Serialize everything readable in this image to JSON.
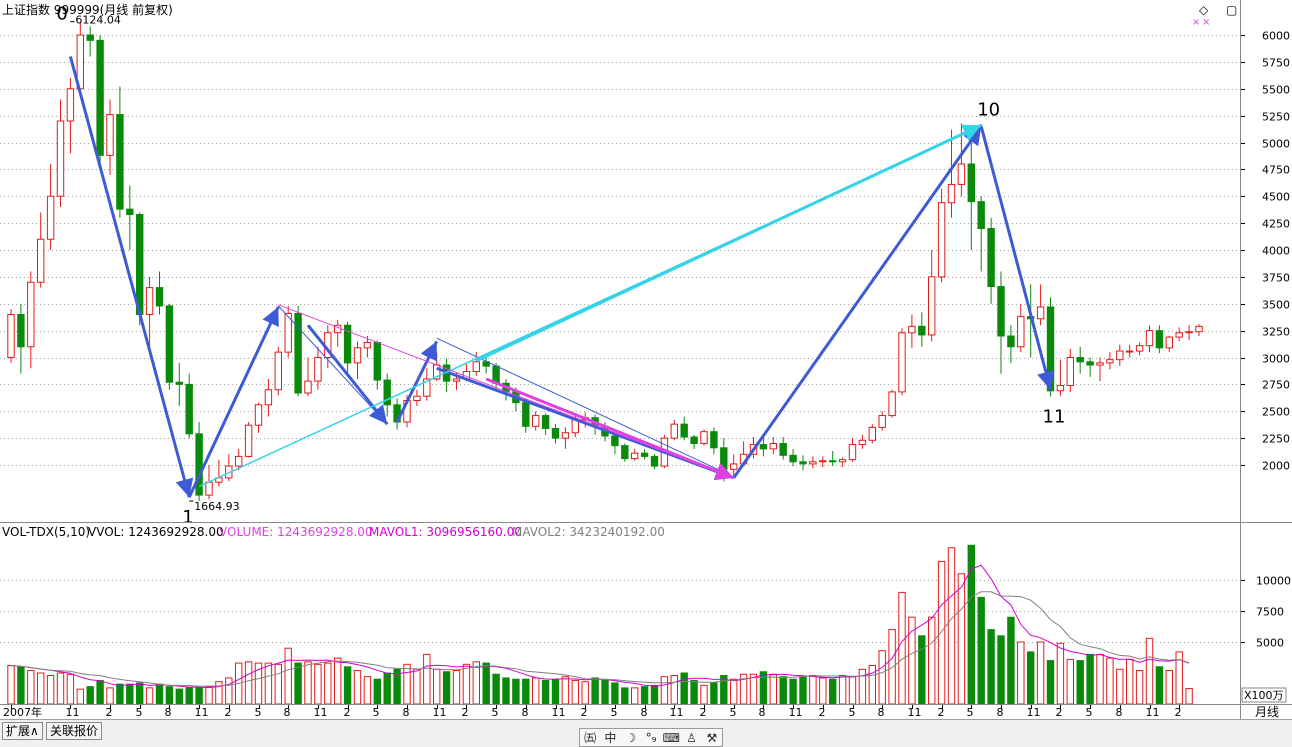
{
  "header": {
    "title": "上证指数 999999(月线 前复权)",
    "corner_icons": [
      "◇",
      "▢"
    ]
  },
  "volume_header": {
    "name": "VOL-TDX(5,10)",
    "vvol": "VVOL: 1243692928.00",
    "volume": "VOLUME: 1243692928.00",
    "mavol1": "MAVOL1: 3096956160.00",
    "mavol2": "MAVOL2: 3423240192.00"
  },
  "bottom_bar": {
    "tab_expand": "扩展∧",
    "tab_quote": "关联报价",
    "tools": [
      {
        "icon": "stock-icon",
        "glyph": "㈤"
      },
      {
        "icon": "chinese-char-icon",
        "glyph": "中"
      },
      {
        "icon": "moon-icon",
        "glyph": "☽"
      },
      {
        "icon": "degree-icon",
        "glyph": "°₉"
      },
      {
        "icon": "keyboard-icon",
        "glyph": "⌨"
      },
      {
        "icon": "person-icon",
        "glyph": "♙"
      },
      {
        "icon": "wrench-icon",
        "glyph": "⚒"
      }
    ]
  },
  "period_label": "月线",
  "colors": {
    "up": "#e21b1b",
    "down": "#0a8a0a",
    "wave": "#3d5bd6",
    "cyan": "#35d3e6",
    "magenta": "#e040e0",
    "ma1": "#d400d4",
    "ma2": "#808080",
    "grid": "#888888"
  },
  "chart_data": [
    {
      "type": "candlestick",
      "title": "上证指数 999999(月线 前复权)",
      "y_ticks": [
        2000,
        2250,
        2500,
        2750,
        3000,
        3250,
        3500,
        3750,
        4000,
        4250,
        4500,
        4750,
        5000,
        5250,
        5500,
        5750,
        6000
      ],
      "ylim": [
        1550,
        6250
      ],
      "x_tick_labels": [
        "2007年",
        "11",
        "2",
        "5",
        "8",
        "11",
        "2",
        "5",
        "8",
        "11",
        "2",
        "5",
        "8",
        "11",
        "2",
        "5",
        "8",
        "11",
        "2",
        "5",
        "8",
        "11",
        "2",
        "5",
        "8",
        "11",
        "2",
        "5",
        "8",
        "11",
        "2",
        "5",
        "8",
        "11",
        "2",
        "5",
        "8",
        "11",
        "2"
      ],
      "x_tick_index": [
        0,
        6,
        10,
        13,
        16,
        19,
        22,
        25,
        28,
        31,
        34,
        37,
        40,
        43,
        46,
        49,
        52,
        55,
        58,
        61,
        64,
        67,
        70,
        73,
        76,
        79,
        82,
        85,
        88,
        91,
        94,
        97,
        100,
        103,
        106,
        109,
        112,
        115,
        118
      ],
      "annotations": [
        {
          "label": "0",
          "price_label": "6124.04",
          "index": 6,
          "price": 6124.04
        },
        {
          "label": "1",
          "price_label": "1664.93",
          "index": 18,
          "price": 1664.93
        },
        {
          "label": "10",
          "index": 98,
          "price": 5178
        },
        {
          "label": "11",
          "index": 105,
          "price": 2638
        }
      ],
      "candles": [
        [
          3000,
          3400,
          3450,
          2950
        ],
        [
          3400,
          3100,
          3500,
          2850
        ],
        [
          3100,
          3700,
          3800,
          2900
        ],
        [
          3700,
          4100,
          4350,
          3650
        ],
        [
          4100,
          4500,
          4800,
          4000
        ],
        [
          4500,
          5200,
          5400,
          4400
        ],
        [
          5200,
          5500,
          5600,
          4900
        ],
        [
          5500,
          6000,
          6124,
          5450
        ],
        [
          6000,
          5950,
          6080,
          5800
        ],
        [
          5950,
          4880,
          6000,
          4780
        ],
        [
          4880,
          5260,
          5400,
          4700
        ],
        [
          5260,
          4380,
          5520,
          4300
        ],
        [
          4380,
          4330,
          4600,
          4000
        ],
        [
          4330,
          3400,
          4350,
          3300
        ],
        [
          3400,
          3650,
          3750,
          3100
        ],
        [
          3650,
          3480,
          3800,
          3400
        ],
        [
          3480,
          2770,
          3500,
          2700
        ],
        [
          2770,
          2750,
          2950,
          2550
        ],
        [
          2750,
          2290,
          2850,
          2250
        ],
        [
          2290,
          1720,
          2400,
          1664.93
        ],
        [
          1720,
          1840,
          2000,
          1680
        ],
        [
          1840,
          1880,
          2050,
          1800
        ],
        [
          1880,
          1990,
          2100,
          1850
        ],
        [
          1990,
          2080,
          2150,
          1950
        ],
        [
          2080,
          2370,
          2400,
          2070
        ],
        [
          2370,
          2560,
          2580,
          2300
        ],
        [
          2560,
          2700,
          2800,
          2450
        ],
        [
          2700,
          3050,
          3100,
          2650
        ],
        [
          3050,
          3410,
          3480,
          3000
        ],
        [
          3410,
          2670,
          3480,
          2640
        ],
        [
          2670,
          2780,
          3000,
          2640
        ],
        [
          2780,
          3000,
          3100,
          2700
        ],
        [
          3000,
          3230,
          3300,
          2900
        ],
        [
          3230,
          3300,
          3350,
          3100
        ],
        [
          3300,
          2950,
          3330,
          2850
        ],
        [
          2950,
          3090,
          3150,
          2800
        ],
        [
          3090,
          3140,
          3200,
          3000
        ],
        [
          3140,
          2790,
          3160,
          2700
        ],
        [
          2790,
          2560,
          2850,
          2450
        ],
        [
          2560,
          2400,
          2620,
          2330
        ],
        [
          2400,
          2600,
          2650,
          2350
        ],
        [
          2600,
          2640,
          2700,
          2550
        ],
        [
          2640,
          2800,
          2900,
          2600
        ],
        [
          2800,
          2930,
          3050,
          2780
        ],
        [
          2930,
          2780,
          2990,
          2680
        ],
        [
          2780,
          2800,
          2860,
          2700
        ],
        [
          2800,
          2870,
          2940,
          2780
        ],
        [
          2870,
          2960,
          3050,
          2830
        ],
        [
          2960,
          2920,
          3000,
          2850
        ],
        [
          2920,
          2760,
          2950,
          2700
        ],
        [
          2760,
          2680,
          2800,
          2600
        ],
        [
          2680,
          2580,
          2720,
          2500
        ],
        [
          2580,
          2360,
          2620,
          2300
        ],
        [
          2360,
          2460,
          2500,
          2320
        ],
        [
          2460,
          2340,
          2480,
          2280
        ],
        [
          2340,
          2250,
          2380,
          2200
        ],
        [
          2250,
          2300,
          2350,
          2150
        ],
        [
          2300,
          2420,
          2470,
          2260
        ],
        [
          2420,
          2440,
          2490,
          2350
        ],
        [
          2440,
          2360,
          2470,
          2280
        ],
        [
          2360,
          2270,
          2400,
          2220
        ],
        [
          2270,
          2180,
          2300,
          2100
        ],
        [
          2180,
          2060,
          2200,
          2030
        ],
        [
          2060,
          2110,
          2150,
          2040
        ],
        [
          2110,
          2080,
          2150,
          2050
        ],
        [
          2080,
          1990,
          2100,
          1960
        ],
        [
          1990,
          2250,
          2280,
          1970
        ],
        [
          2250,
          2380,
          2420,
          2230
        ],
        [
          2380,
          2260,
          2450,
          2230
        ],
        [
          2260,
          2200,
          2280,
          2150
        ],
        [
          2200,
          2310,
          2330,
          2180
        ],
        [
          2310,
          2160,
          2350,
          2100
        ],
        [
          2160,
          1960,
          2250,
          1849
        ],
        [
          1960,
          2010,
          2100,
          1900
        ],
        [
          2010,
          2100,
          2220,
          1990
        ],
        [
          2100,
          2190,
          2260,
          2060
        ],
        [
          2190,
          2150,
          2270,
          2080
        ],
        [
          2150,
          2200,
          2260,
          2100
        ],
        [
          2200,
          2090,
          2260,
          2050
        ],
        [
          2090,
          2030,
          2150,
          1990
        ],
        [
          2030,
          2010,
          2090,
          1950
        ],
        [
          2010,
          2030,
          2080,
          1970
        ],
        [
          2030,
          2040,
          2080,
          1980
        ],
        [
          2040,
          2030,
          2130,
          1990
        ],
        [
          2030,
          2050,
          2070,
          1980
        ],
        [
          2050,
          2190,
          2250,
          2030
        ],
        [
          2190,
          2230,
          2280,
          2150
        ],
        [
          2230,
          2350,
          2380,
          2200
        ],
        [
          2350,
          2460,
          2500,
          2320
        ],
        [
          2460,
          2680,
          2700,
          2440
        ],
        [
          2680,
          3230,
          3270,
          2650
        ],
        [
          3230,
          3290,
          3400,
          3090
        ],
        [
          3290,
          3210,
          3420,
          3100
        ],
        [
          3210,
          3750,
          4000,
          3150
        ],
        [
          3750,
          4440,
          4570,
          3700
        ],
        [
          4440,
          4610,
          5120,
          4300
        ],
        [
          4610,
          4800,
          5178,
          4500
        ],
        [
          4800,
          4450,
          5000,
          4000
        ],
        [
          4450,
          4200,
          4500,
          3800
        ],
        [
          4200,
          3660,
          4300,
          3500
        ],
        [
          3660,
          3200,
          3800,
          2850
        ],
        [
          3200,
          3100,
          3300,
          2950
        ],
        [
          3100,
          3380,
          3500,
          3050
        ],
        [
          3380,
          3360,
          3680,
          3000
        ],
        [
          3360,
          3470,
          3680,
          3300
        ],
        [
          3470,
          2690,
          3560,
          2638
        ],
        [
          2690,
          2740,
          2980,
          2640
        ],
        [
          2740,
          3000,
          3080,
          2680
        ],
        [
          3000,
          2960,
          3100,
          2850
        ],
        [
          2960,
          2930,
          3000,
          2820
        ],
        [
          2930,
          2950,
          3000,
          2780
        ],
        [
          2950,
          2980,
          3050,
          2890
        ],
        [
          2980,
          3060,
          3120,
          2920
        ],
        [
          3060,
          3060,
          3120,
          3000
        ],
        [
          3060,
          3110,
          3140,
          3020
        ],
        [
          3110,
          3250,
          3300,
          3050
        ],
        [
          3250,
          3090,
          3300,
          3040
        ],
        [
          3090,
          3190,
          3200,
          3050
        ],
        [
          3190,
          3230,
          3280,
          3150
        ],
        [
          3230,
          3240,
          3300,
          3160
        ],
        [
          3240,
          3290,
          3310,
          3200
        ]
      ]
    },
    {
      "type": "bar",
      "title": "VOL-TDX(5,10)",
      "unit_label": "X100万",
      "y_ticks": [
        5000,
        7500,
        10000
      ],
      "ylim": [
        0,
        13500
      ],
      "values": [
        3100,
        3000,
        2700,
        2500,
        2300,
        2500,
        2400,
        1200,
        1400,
        1900,
        1300,
        1600,
        1600,
        1700,
        1300,
        1600,
        1400,
        1200,
        1300,
        1300,
        1400,
        1800,
        2100,
        3300,
        3400,
        3300,
        3300,
        3200,
        4500,
        3300,
        3400,
        3200,
        3300,
        3700,
        3000,
        2700,
        2200,
        2000,
        2500,
        2800,
        3200,
        2800,
        4000,
        2800,
        2600,
        2700,
        3200,
        3400,
        3300,
        2400,
        2100,
        2000,
        2000,
        2100,
        1900,
        2000,
        2200,
        1900,
        1800,
        2100,
        1900,
        1700,
        1300,
        1300,
        1400,
        1500,
        2200,
        2300,
        2500,
        1900,
        1500,
        1700,
        2300,
        2000,
        2400,
        2400,
        2600,
        2400,
        2200,
        2000,
        2200,
        2300,
        2100,
        2000,
        2300,
        2200,
        2800,
        3100,
        4300,
        6000,
        9000,
        7000,
        5500,
        7000,
        11500,
        12600,
        10500,
        12800,
        8600,
        6000,
        5500,
        7000,
        5000,
        4200,
        5000,
        3500,
        4900,
        3600,
        3500,
        4000,
        4000,
        3700,
        2800,
        3600,
        2700,
        5300,
        3000,
        2700,
        4200,
        1244
      ]
    }
  ]
}
